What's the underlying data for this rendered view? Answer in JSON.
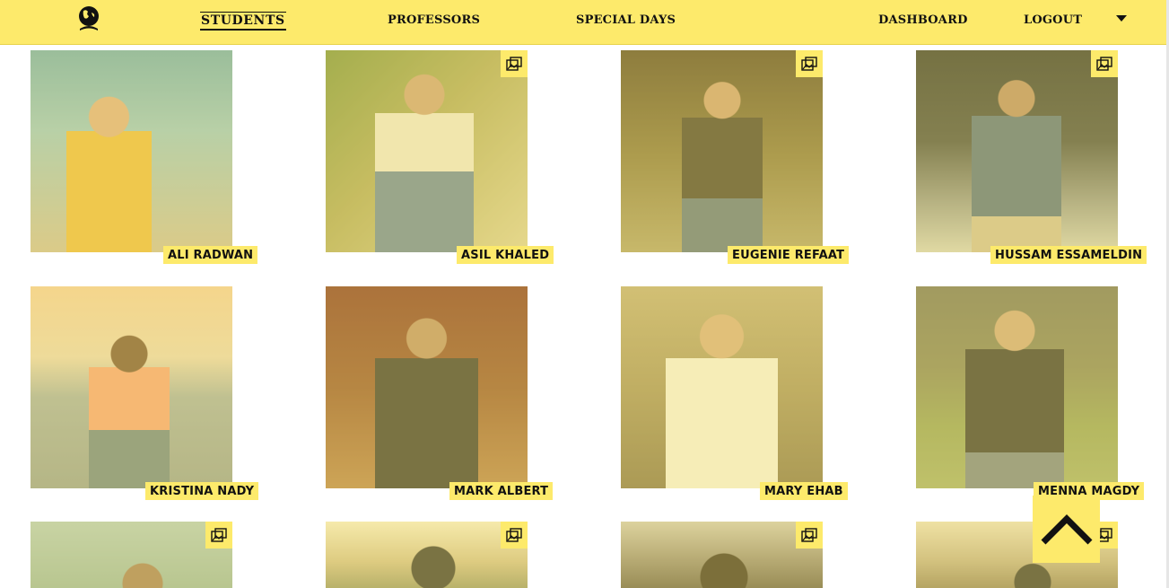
{
  "nav": {
    "items": [
      "STUDENTS",
      "PROFESSORS",
      "SPECIAL DAYS"
    ],
    "right_items": [
      "DASHBOARD",
      "LOGOUT"
    ],
    "active": "STUDENTS"
  },
  "students": [
    {
      "name": "ALI RADWAN"
    },
    {
      "name": "ASIL KHALED"
    },
    {
      "name": "EUGENIE REFAAT"
    },
    {
      "name": "HUSSAM ESSAMELDIN"
    },
    {
      "name": "KRISTINA NADY"
    },
    {
      "name": "MARK ALBERT"
    },
    {
      "name": "MARY EHAB"
    },
    {
      "name": "MENNA MAGDY"
    }
  ],
  "colors": {
    "accent": "#fdea6b",
    "text": "#111111"
  },
  "icons": {
    "gallery": "gallery-icon",
    "logo": "globe-logo-icon",
    "scroll_top": "chevron-up-icon",
    "dropdown": "caret-down-icon"
  }
}
